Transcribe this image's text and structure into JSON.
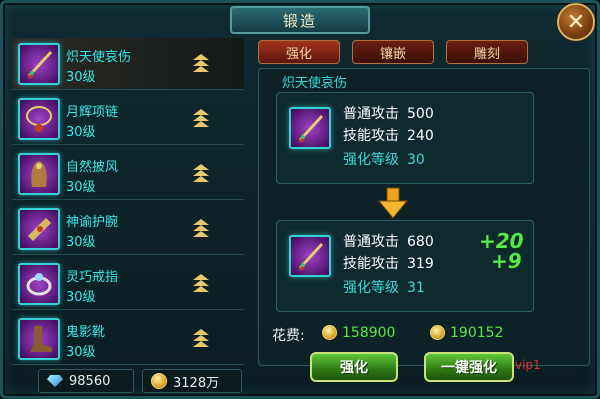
{
  "window": {
    "title": "锻造",
    "close_icon": "close-icon"
  },
  "tabs": [
    {
      "label": "强化",
      "active": true
    },
    {
      "label": "镶嵌",
      "active": false
    },
    {
      "label": "雕刻",
      "active": false
    }
  ],
  "items": [
    {
      "name": "炽天使哀伤",
      "level": "30级",
      "icon": "sword-icon",
      "selected": true
    },
    {
      "name": "月辉项链",
      "level": "30级",
      "icon": "necklace-icon",
      "selected": false
    },
    {
      "name": "自然披风",
      "level": "30级",
      "icon": "cloak-icon",
      "selected": false
    },
    {
      "name": "神谕护腕",
      "level": "30级",
      "icon": "bracer-icon",
      "selected": false
    },
    {
      "name": "灵巧戒指",
      "level": "30级",
      "icon": "ring-icon",
      "selected": false
    },
    {
      "name": "鬼影靴",
      "level": "30级",
      "icon": "boots-icon",
      "selected": false
    }
  ],
  "currency": {
    "diamonds": "98560",
    "gold": "3128万"
  },
  "detail": {
    "item_name": "炽天使哀伤",
    "current": {
      "normal_attack_label": "普通攻击",
      "normal_attack": "500",
      "skill_attack_label": "技能攻击",
      "skill_attack": "240",
      "enhance_level_label": "强化等级",
      "enhance_level": "30"
    },
    "next": {
      "normal_attack_label": "普通攻击",
      "normal_attack": "680",
      "skill_attack_label": "技能攻击",
      "skill_attack": "319",
      "enhance_level_label": "强化等级",
      "enhance_level": "31",
      "bonus_normal": "+20",
      "bonus_skill": "+9"
    }
  },
  "cost": {
    "label": "花费:",
    "coin_a": "158900",
    "coin_b": "190152"
  },
  "buttons": {
    "enhance": "强化",
    "one_click_enhance": "一键强化",
    "vip_tag": "vip1"
  },
  "colors": {
    "accent_cyan": "#38e8e8",
    "green": "#54e84a",
    "tab_red": "#a2341c"
  }
}
